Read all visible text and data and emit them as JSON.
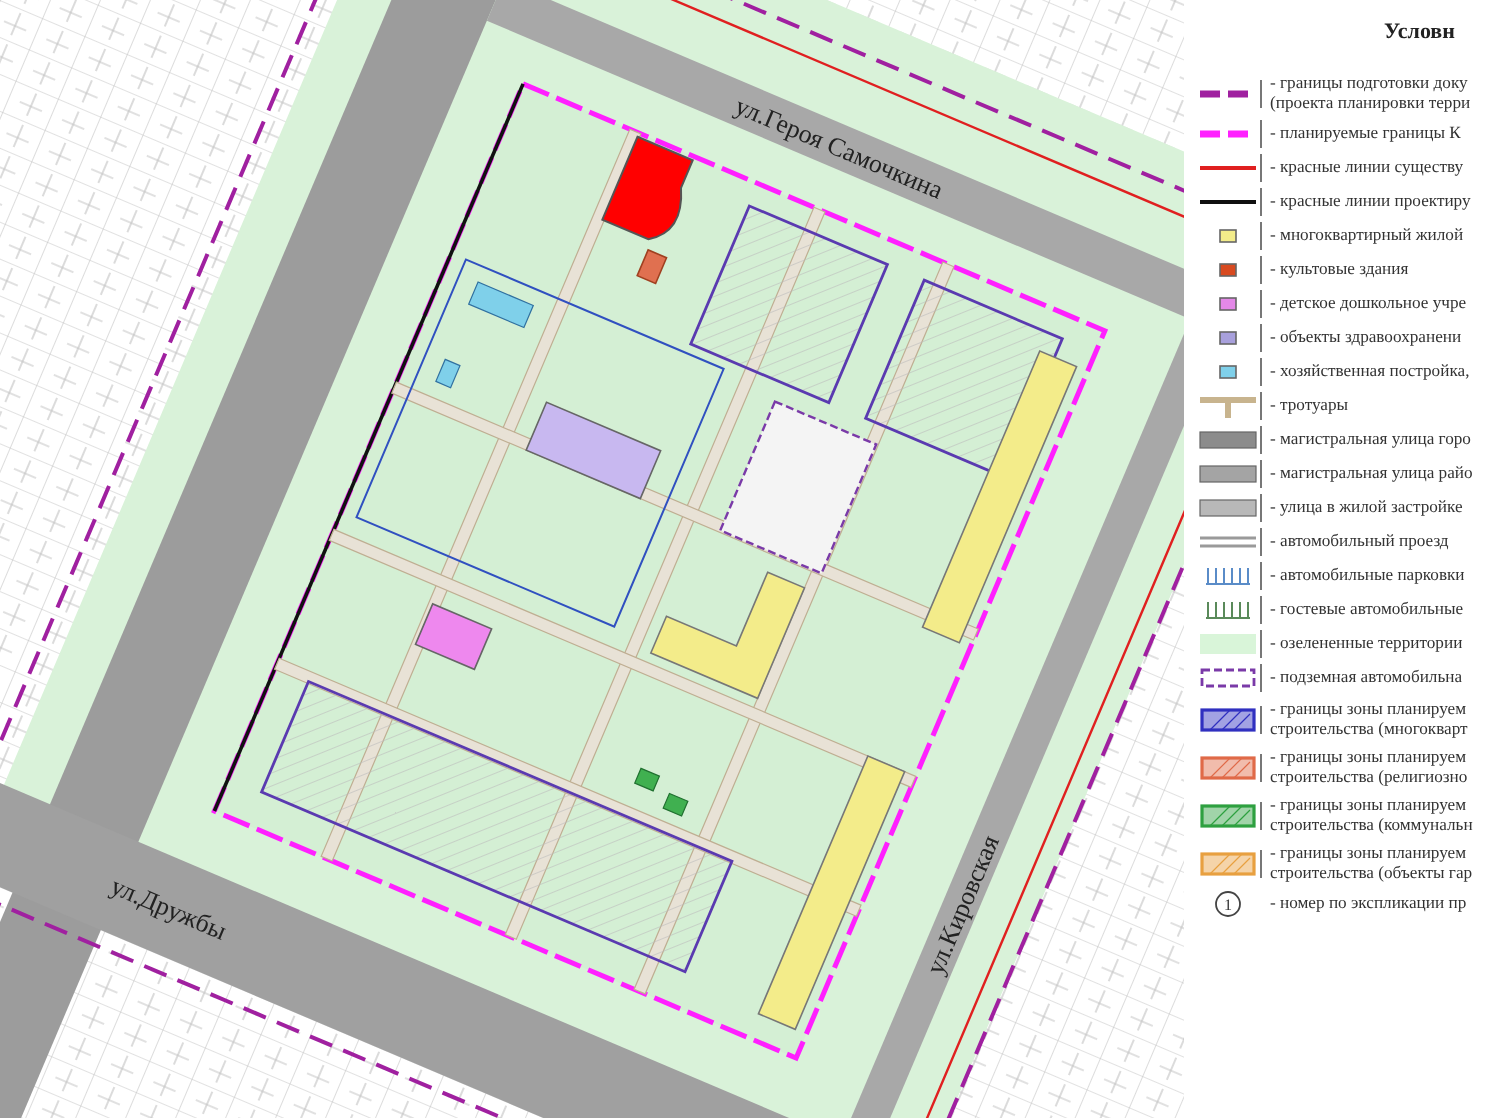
{
  "map": {
    "streets": [
      {
        "name": "ул.Героя Самочкина",
        "kind": "top"
      },
      {
        "name": "ул.Кировская",
        "kind": "right"
      },
      {
        "name": "ул.Дружбы",
        "kind": "bottom"
      }
    ]
  },
  "legend": {
    "title": "Условн",
    "items": [
      {
        "kind": "dashed-line",
        "color": "#a020a0",
        "lines": [
          "- границы подготовки доку",
          "(проекта планировки терри"
        ]
      },
      {
        "kind": "dashed-line",
        "color": "#ff20ff",
        "lines": [
          "- планируемые границы К"
        ]
      },
      {
        "kind": "line",
        "color": "#e02020",
        "lines": [
          "- красные линии существу"
        ]
      },
      {
        "kind": "line",
        "color": "#101010",
        "lines": [
          "- красные линии проектиру"
        ]
      },
      {
        "kind": "square",
        "color": "#f3ec8a",
        "lines": [
          "- многоквартирный жилой"
        ]
      },
      {
        "kind": "square",
        "color": "#d84a20",
        "lines": [
          "- культовые здания"
        ]
      },
      {
        "kind": "square",
        "color": "#e488e8",
        "lines": [
          "- детское дошкольное учре"
        ]
      },
      {
        "kind": "square",
        "color": "#a8a0dc",
        "lines": [
          "- объекты здравоохранени"
        ]
      },
      {
        "kind": "square",
        "color": "#7fd0ea",
        "lines": [
          "- хозяйственная постройка,"
        ]
      },
      {
        "kind": "sidewalk",
        "color": "#c8b48e",
        "lines": [
          "- тротуары"
        ]
      },
      {
        "kind": "road",
        "color": "#8c8c8c",
        "lines": [
          "- магистральная улица горо"
        ]
      },
      {
        "kind": "road",
        "color": "#a4a4a4",
        "lines": [
          "- магистральная улица райо"
        ]
      },
      {
        "kind": "road",
        "color": "#b8b8b8",
        "lines": [
          "- улица в жилой застройке"
        ]
      },
      {
        "kind": "driveway",
        "color": "#9a9a9a",
        "lines": [
          "- автомобильный проезд"
        ]
      },
      {
        "kind": "parking",
        "color": "#5a8cc8",
        "lines": [
          "- автомобильные парковки"
        ]
      },
      {
        "kind": "parking",
        "color": "#5a8a5a",
        "lines": [
          "- гостевые автомобильные"
        ]
      },
      {
        "kind": "area",
        "color": "#d9f5d9",
        "lines": [
          "- озелененные территории"
        ]
      },
      {
        "kind": "dashed-box",
        "color": "#7a3aa8",
        "lines": [
          "- подземная автомобильна"
        ]
      },
      {
        "kind": "zone",
        "color": "#3030c0",
        "lines": [
          "- границы зоны планируем",
          "строительства (многокварт"
        ]
      },
      {
        "kind": "zone",
        "color": "#e06a48",
        "lines": [
          "- границы зоны планируем",
          "строительства (религиозно"
        ]
      },
      {
        "kind": "zone",
        "color": "#2ea040",
        "lines": [
          "- границы зоны планируем",
          "строительства (коммунальн"
        ]
      },
      {
        "kind": "zone",
        "color": "#e8a040",
        "lines": [
          "- границы зоны планируем",
          "строительства (объекты гар"
        ]
      },
      {
        "kind": "number",
        "number": "1",
        "lines": [
          "- номер по экспликации пр"
        ]
      }
    ]
  }
}
